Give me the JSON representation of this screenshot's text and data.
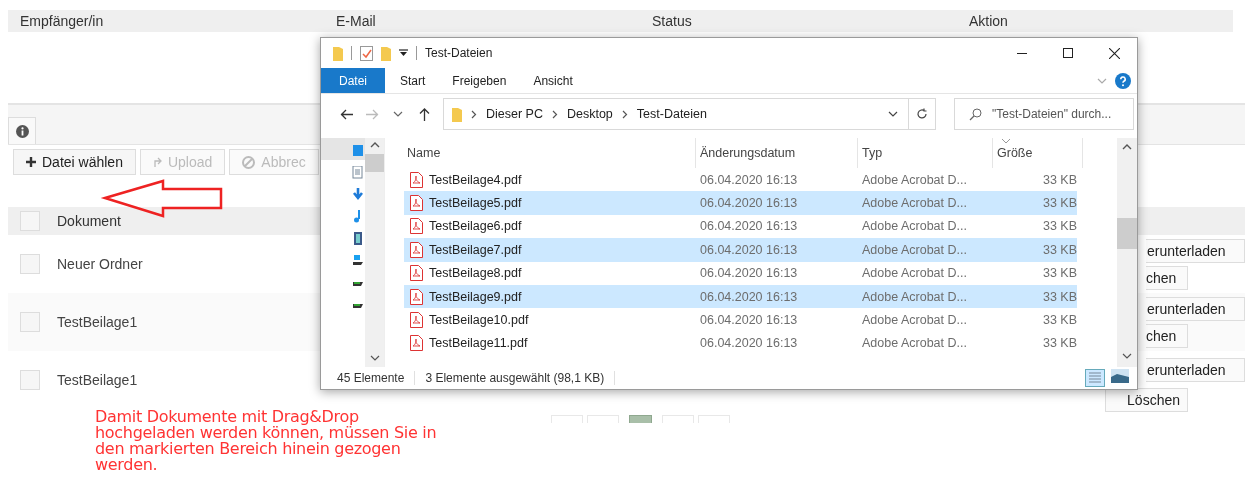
{
  "recipients_table": {
    "columns": [
      "Empfänger/in",
      "E-Mail",
      "Status",
      "Aktion"
    ]
  },
  "toolbar": {
    "buttons": [
      {
        "kind": "plus",
        "label": "Datei wählen",
        "disabled": false
      },
      {
        "kind": "upload",
        "label": "Upload",
        "disabled": true
      },
      {
        "kind": "cancel",
        "label": "Abbrec",
        "disabled": true
      }
    ]
  },
  "documents_table": {
    "column": "Dokument",
    "header_checked": false,
    "rows": [
      {
        "name": "Neuer Ordner",
        "checked": false,
        "download": "erunterladen",
        "delete": "chen"
      },
      {
        "name": "TestBeilage1",
        "checked": false,
        "download": "erunterladen",
        "delete": "chen"
      },
      {
        "name": "TestBeilage1",
        "checked": false,
        "download": "erunterladen",
        "delete": "Löschen"
      }
    ]
  },
  "hint_lines": [
    "Damit Dokumente mit Drag&Drop",
    "hochgeladen werden können, müssen Sie in",
    "den markierten Bereich hinein gezogen",
    "werden."
  ],
  "pagination": [
    {
      "selected": false
    },
    {
      "selected": false
    },
    {
      "selected": true
    },
    {
      "selected": false
    },
    {
      "selected": false
    }
  ],
  "explorer": {
    "title": "Test-Dateien",
    "ribbon_tabs": [
      {
        "label": "Datei",
        "selected": true
      },
      {
        "label": "Start",
        "selected": false
      },
      {
        "label": "Freigeben",
        "selected": false
      },
      {
        "label": "Ansicht",
        "selected": false
      }
    ],
    "breadcrumb": [
      "Dieser PC",
      "Desktop",
      "Test-Dateien"
    ],
    "search": {
      "placeholder": "\"Test-Dateien\" durch..."
    },
    "columns": [
      "Name",
      "Änderungsdatum",
      "Typ",
      "Größe"
    ],
    "files": [
      {
        "name": "TestBeilage4.pdf",
        "modified": "06.04.2020 16:13",
        "type": "Adobe Acrobat D...",
        "size": "33 KB",
        "selected": false
      },
      {
        "name": "TestBeilage5.pdf",
        "modified": "06.04.2020 16:13",
        "type": "Adobe Acrobat D...",
        "size": "33 KB",
        "selected": true
      },
      {
        "name": "TestBeilage6.pdf",
        "modified": "06.04.2020 16:13",
        "type": "Adobe Acrobat D...",
        "size": "33 KB",
        "selected": false
      },
      {
        "name": "TestBeilage7.pdf",
        "modified": "06.04.2020 16:13",
        "type": "Adobe Acrobat D...",
        "size": "33 KB",
        "selected": true
      },
      {
        "name": "TestBeilage8.pdf",
        "modified": "06.04.2020 16:13",
        "type": "Adobe Acrobat D...",
        "size": "33 KB",
        "selected": false
      },
      {
        "name": "TestBeilage9.pdf",
        "modified": "06.04.2020 16:13",
        "type": "Adobe Acrobat D...",
        "size": "33 KB",
        "selected": true
      },
      {
        "name": "TestBeilage10.pdf",
        "modified": "06.04.2020 16:13",
        "type": "Adobe Acrobat D...",
        "size": "33 KB",
        "selected": false
      },
      {
        "name": "TestBeilage11.pdf",
        "modified": "06.04.2020 16:13",
        "type": "Adobe Acrobat D...",
        "size": "33 KB",
        "selected": false
      }
    ],
    "status": {
      "count": "45 Elemente",
      "selection": "3 Elemente ausgewählt (98,1 KB)"
    }
  }
}
